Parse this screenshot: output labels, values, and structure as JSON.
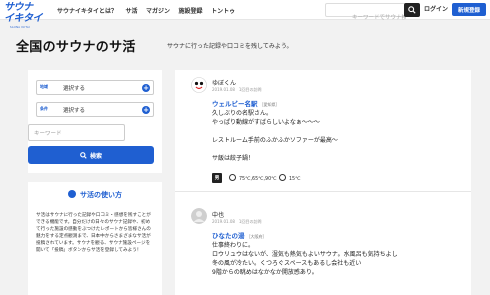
{
  "header": {
    "logo_line1": "サウナ",
    "logo_line2": "イキタイ",
    "logo_sub": "SAUNA IKITAI",
    "nav": [
      "サウナイキタイとは？",
      "サ活",
      "マガジン",
      "施設登録",
      "トントゥ"
    ],
    "search_placeholder": "キーワードでサウナ検索",
    "login": "ログイン",
    "signup": "新規登録"
  },
  "page": {
    "title": "全国のサウナのサ活",
    "subtitle": "サウナに行った記録や口コミを残してみよう。"
  },
  "filters": {
    "area_tag": "地域",
    "area_value": "選択する",
    "cond_tag": "条件",
    "cond_value": "選択する",
    "keyword_placeholder": "キーワード",
    "submit": "検索"
  },
  "howto": {
    "title": "サ活の使い方",
    "body": "サ活はサウナに行った記録や口コミ・感想を残すことができる機能です。自分だけの日々のサウナ記録や、初めて行った施設の感動をぶつけたレポートから皆様さんの魅力をする定点観測まで、日本中からさまざまなサ活が投稿されています。サウナを観る、サウナ施設ページを開いて「投稿」ボタンからサ活を登録してみよう！"
  },
  "posts": [
    {
      "user": "ゆぼくん",
      "date": "2019.01.08　1回目の訪問",
      "facility": "ウェルビー名駅",
      "pref": "［愛知県］",
      "lines": [
        "久しぶりの名駅さん。",
        "やっぱり動線がすばらしいよなぁ〜〜〜",
        "",
        "レストルーム手前のふかふかソファーが最高〜",
        "",
        "サ飯は餃子鍋！"
      ],
      "badge": "男",
      "sauna_temp": "75℃,65℃,90℃",
      "water_temp": "15℃"
    },
    {
      "user": "中也",
      "date": "2019.01.08　1回目の訪問",
      "facility": "ひなたの湯",
      "pref": "［大阪府］",
      "lines": [
        "仕事終わりに。",
        "ロウリュウはないが、湿気も熱気もよいサウナ。水風呂も気持ちよし",
        "冬の風が冷たい。くつろぐスペースもあるし会社も近い",
        "9階からの眺めはなかなか開放感あり。"
      ]
    }
  ]
}
